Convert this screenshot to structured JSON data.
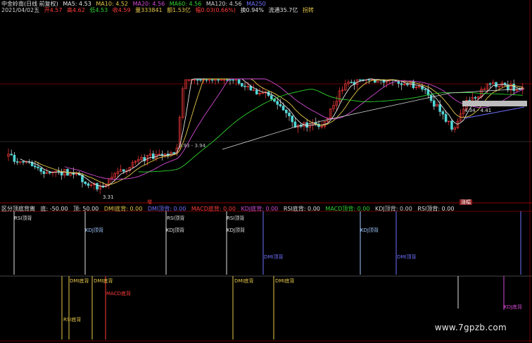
{
  "header": {
    "stock": "中金岭南(日线 前复权)",
    "ma5": "MA5: 4.53",
    "ma10": "MA10: 4.52",
    "ma20": "MA20: 4.56",
    "ma60": "MA60: 4.56",
    "ma120": "MA120: 4.56",
    "ma250": "MA250",
    "date": "2021/04/02五",
    "open": "开4.57",
    "high": "高4.62",
    "low": "低4.53",
    "close": "收4.59",
    "volume": "量333841",
    "amount": "额1.53亿",
    "change": "幅0.03(0.66%)",
    "turnover": "换0.94%",
    "float": "流通35.7亿",
    "tag": "拐转"
  },
  "colors": {
    "ma5": "#e6e6e6",
    "ma10": "#e6c84a",
    "ma20": "#d24ad2",
    "ma60": "#2fd22f",
    "ma120": "#d0d0d0",
    "ma250": "#6f6fff",
    "up": "#ff3b3b",
    "down": "#4fd6d6",
    "panel_line": "#8b0000"
  },
  "annotations": {
    "low_price": "3.31",
    "mid_range": "3.93 - 3.94",
    "right_range": "4.34 - 4.41",
    "up_marker": "增",
    "right_marker": "涨幅"
  },
  "indicator": {
    "title": "区分顶底背离",
    "bottom": "底: -50.00",
    "top": "顶: 50.00",
    "dmi_bottom": "DMI底背: 0.00",
    "dmi_top": "DMI顶背: 0.00",
    "macd_bottom": "MACD底背: 0.00",
    "kdj_bottom": "KDJ底背: 0.00",
    "rsi_bottom": "RSI底背: 0.00",
    "macd_top": "MACD顶背: 0.00",
    "kdj_top": "KDJ顶背: 0.00",
    "rsi_top": "RSI顶背: 0.00"
  },
  "signals": {
    "rsi_top": "RSI顶背",
    "kdj_top": "KDJ顶背",
    "dmi_top": "DMI顶背",
    "dmi_bottom": "DMI底背",
    "macd_bottom": "MACD底背",
    "rsi_bottom": "RSI底背",
    "kdj_bottom": "KDJ底背"
  },
  "watermark": "www.7gpzb.com"
}
